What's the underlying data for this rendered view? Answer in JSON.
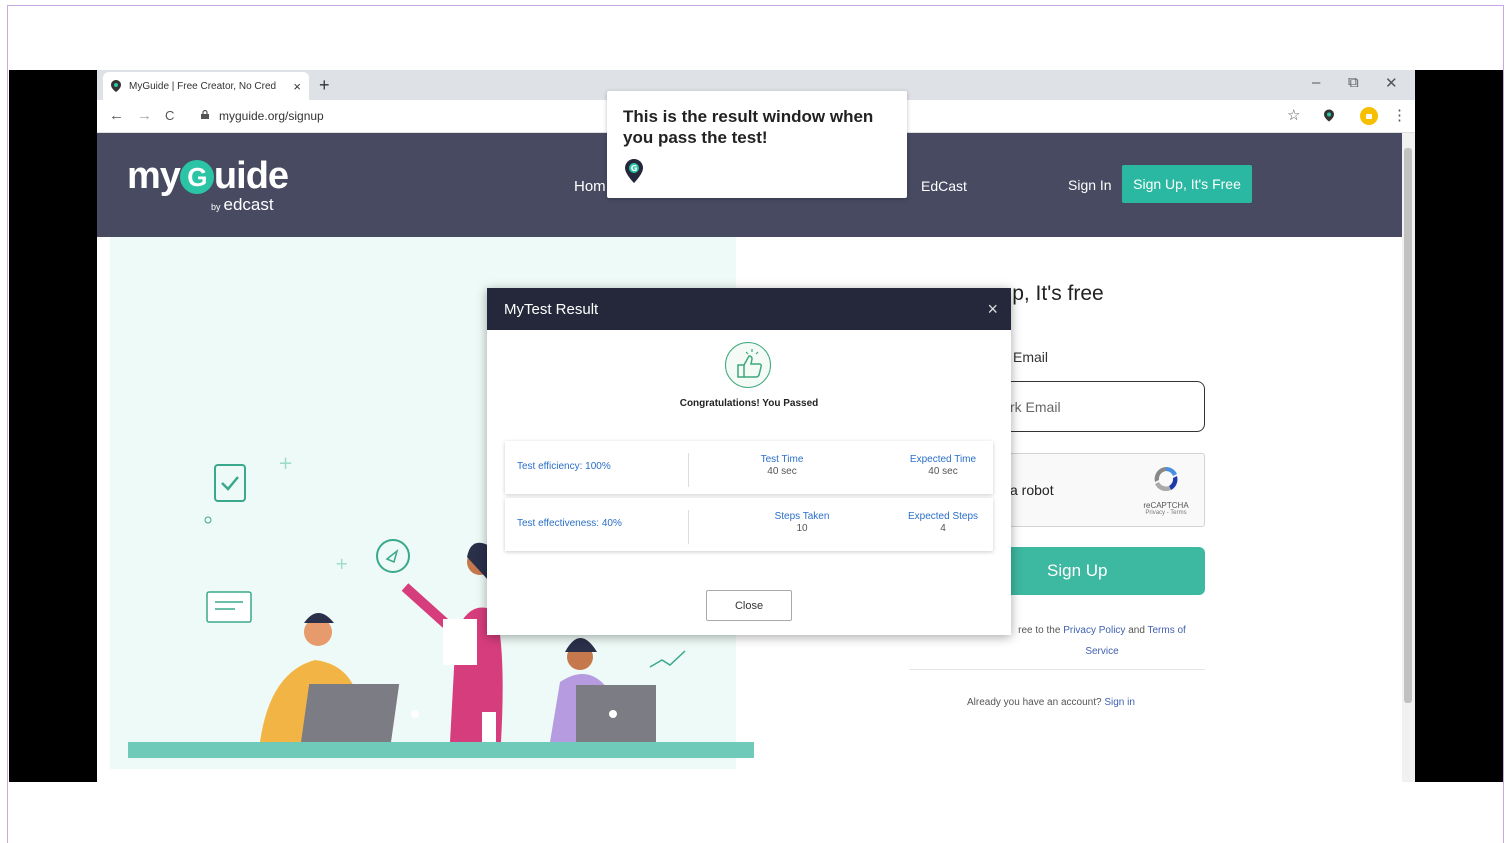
{
  "browser": {
    "tab_title": "MyGuide | Free Creator, No Cred",
    "tab_close": "×",
    "new_tab": "+",
    "url": "myguide.org/signup",
    "minimize": "–",
    "restore": "⧉",
    "close": "✕",
    "back": "←",
    "forward": "→",
    "reload": "C",
    "star": "☆",
    "menu": "⋮"
  },
  "header": {
    "logo_text_1": "my",
    "logo_g": "G",
    "logo_text_2": "uide",
    "logo_by": "by",
    "logo_sub": "edcast",
    "nav_home": "Hom",
    "nav_edcast": "EdCast",
    "sign_in": "Sign In",
    "signup_button": "Sign Up, It's Free"
  },
  "form": {
    "title": "n up, It's free",
    "email_label": "Email",
    "email_placeholder": "rk Email",
    "captcha_text": "a robot",
    "captcha_label": "reCAPTCHA",
    "captcha_sub": "Privacy - Terms",
    "signup_button": "Sign Up",
    "terms_prefix": "ree to the ",
    "privacy_link": "Privacy Policy",
    "terms_and": " and ",
    "terms_link": "Terms of",
    "service_link": "Service",
    "already_text": "Already you have an account? ",
    "sign_in_link": "Sign in"
  },
  "modal": {
    "title": "MyTest Result",
    "close_icon": "×",
    "congrats": "Congratulations! You Passed",
    "efficiency": {
      "label": "Test efficiency: 100%",
      "col1_key": "Test Time",
      "col1_val": "40 sec",
      "col2_key": "Expected Time",
      "col2_val": "40 sec"
    },
    "effectiveness": {
      "label": "Test effectiveness: 40%",
      "col1_key": "Steps Taken",
      "col1_val": "10",
      "col2_key": "Expected Steps",
      "col2_val": "4"
    },
    "close_button": "Close"
  },
  "tooltip": {
    "text": "This is the result window when you pass the test!",
    "icon_letter": "G"
  },
  "colors": {
    "header_bg": "#474a61",
    "accent": "#2bb8a2",
    "modal_head": "#24283a",
    "link": "#2a6fc9"
  },
  "icons": [
    "myguide-pin-icon",
    "lock-icon",
    "star-icon",
    "thumbs-up-icon",
    "recaptcha-icon",
    "close-icon"
  ]
}
